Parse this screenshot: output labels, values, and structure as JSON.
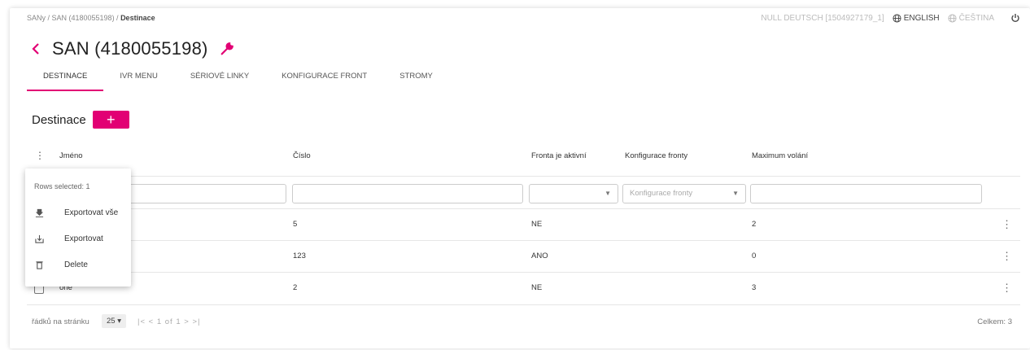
{
  "breadcrumb": {
    "path": "SANy / SAN (4180055198) / ",
    "current": "Destinace"
  },
  "topbar": {
    "user": "NULL DEUTSCH [1504927179_1]",
    "lang_en": "ENGLISH",
    "lang_cs": "ČEŠTINA"
  },
  "page": {
    "title": "SAN (4180055198)"
  },
  "tabs": [
    "DESTINACE",
    "IVR MENU",
    "SÉRIOVÉ LINKY",
    "KONFIGURACE FRONT",
    "STROMY"
  ],
  "section": {
    "title": "Destinace",
    "add_label": "+"
  },
  "table": {
    "columns": {
      "name": "Jméno",
      "number": "Číslo",
      "queue_active": "Fronta je aktivní",
      "queue_config": "Konfigurace fronty",
      "max_calls": "Maximum volání"
    },
    "filters": {
      "queue_config_placeholder": "Konfigurace fronty"
    },
    "rows": [
      {
        "name": "",
        "number": "5",
        "queue_active": "NE",
        "max_calls": "2"
      },
      {
        "name": "",
        "number": "123",
        "queue_active": "ANO",
        "max_calls": "0"
      },
      {
        "name": "one",
        "number": "2",
        "queue_active": "NE",
        "max_calls": "3"
      }
    ]
  },
  "menu": {
    "header": "Rows selected: 1",
    "items": [
      "Exportovat vše",
      "Exportovat",
      "Delete"
    ]
  },
  "footer": {
    "rows_per_page_label": "řádků na stránku",
    "rows_per_page_value": "25",
    "pager": "|<  <  1 of 1  >  >|",
    "total": "Celkem: 3"
  },
  "colors": {
    "accent": "#e20074"
  }
}
